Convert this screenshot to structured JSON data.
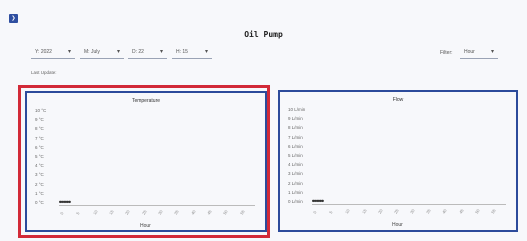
{
  "header": {
    "title": "Oil Pump",
    "toggle_icon": "chevron-right-icon"
  },
  "filters": {
    "year": "Y: 2022",
    "month": "M: July",
    "day": "D: 22",
    "hour": "H: 15",
    "filter_label": "Filter:",
    "filter_value": "Hour"
  },
  "last_update": "Last Update:",
  "charts": {
    "temperature": {
      "title": "Temperature",
      "yticks": [
        "10 °C",
        "9 °C",
        "8 °C",
        "7 °C",
        "6 °C",
        "5 °C",
        "4 °C",
        "3 °C",
        "2 °C",
        "1 °C",
        "0 °C"
      ],
      "xticks": [
        "0",
        "5",
        "10",
        "15",
        "20",
        "25",
        "30",
        "35",
        "40",
        "45",
        "50",
        "55"
      ],
      "xlabel": "Hour",
      "dots": "●●●●●●"
    },
    "flow": {
      "title": "Flow",
      "yticks": [
        "10 L/min",
        "9 L/min",
        "8 L/min",
        "7 L/min",
        "6 L/min",
        "5 L/min",
        "4 L/min",
        "3 L/min",
        "2 L/min",
        "1 L/min",
        "0 L/min"
      ],
      "xticks": [
        "0",
        "5",
        "10",
        "15",
        "20",
        "25",
        "30",
        "35",
        "40",
        "45",
        "50",
        "55"
      ],
      "xlabel": "Hour",
      "dots": "●●●●●●"
    }
  },
  "chart_data": [
    {
      "type": "line",
      "title": "Temperature",
      "xlabel": "Hour",
      "ylabel": "",
      "ylim": [
        0,
        10
      ],
      "series": [
        {
          "values": [
            0,
            0,
            0,
            0,
            0,
            0
          ]
        }
      ]
    },
    {
      "type": "line",
      "title": "Flow",
      "xlabel": "Hour",
      "ylabel": "",
      "ylim": [
        0,
        10
      ],
      "series": [
        {
          "values": [
            0,
            0,
            0,
            0,
            0,
            0
          ]
        }
      ]
    }
  ],
  "colors": {
    "accent": "#2c4b9b",
    "highlight": "#d22a38"
  }
}
